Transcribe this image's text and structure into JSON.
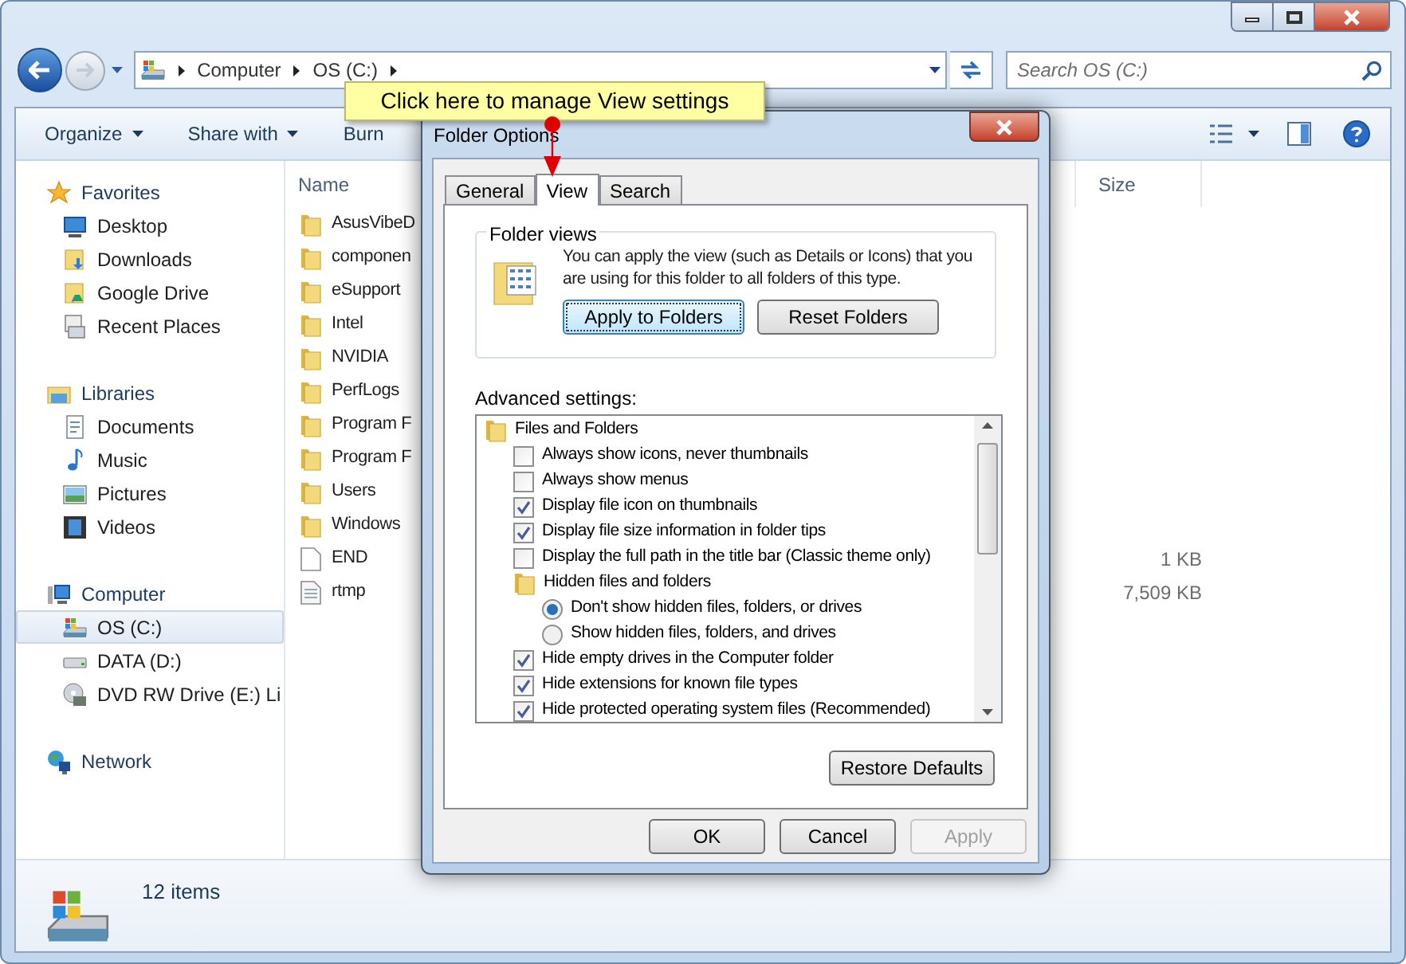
{
  "nav": {
    "breadcrumbs": [
      "Computer",
      "OS (C:)"
    ],
    "search": {
      "placeholder": "Search OS (C:)"
    }
  },
  "toolbar": [
    {
      "label": "Organize",
      "has_menu": true
    },
    {
      "label": "Share with",
      "has_menu": true
    },
    {
      "label": "Burn",
      "has_menu": false
    }
  ],
  "sidebar": [
    {
      "label": "Favorites",
      "selected": false,
      "children": [
        {
          "label": "Desktop",
          "selected": false
        },
        {
          "label": "Downloads",
          "selected": false
        },
        {
          "label": "Google Drive",
          "selected": false
        },
        {
          "label": "Recent Places",
          "selected": false
        }
      ]
    },
    {
      "label": "Libraries",
      "selected": false,
      "children": [
        {
          "label": "Documents",
          "selected": false
        },
        {
          "label": "Music",
          "selected": false
        },
        {
          "label": "Pictures",
          "selected": false
        },
        {
          "label": "Videos",
          "selected": false
        }
      ]
    },
    {
      "label": "Computer",
      "selected": false,
      "children": [
        {
          "label": "OS (C:)",
          "selected": true
        },
        {
          "label": "DATA (D:)",
          "selected": false
        },
        {
          "label": "DVD RW Drive (E:) Li",
          "selected": false
        }
      ]
    },
    {
      "label": "Network",
      "selected": false
    }
  ],
  "columns": [
    "Name",
    "Size"
  ],
  "files": [
    {
      "name": "AsusVibeD",
      "kind": "folder"
    },
    {
      "name": "componen",
      "kind": "folder"
    },
    {
      "name": "eSupport",
      "kind": "folder"
    },
    {
      "name": "Intel",
      "kind": "folder"
    },
    {
      "name": "NVIDIA",
      "kind": "folder"
    },
    {
      "name": "PerfLogs",
      "kind": "folder"
    },
    {
      "name": "Program F",
      "kind": "folder"
    },
    {
      "name": "Program F",
      "kind": "folder"
    },
    {
      "name": "Users",
      "kind": "folder"
    },
    {
      "name": "Windows",
      "kind": "folder"
    },
    {
      "name": "END",
      "kind": "file",
      "size": "1 KB"
    },
    {
      "name": "rtmp",
      "kind": "text",
      "size": "7,509 KB"
    }
  ],
  "status": "12 items",
  "callout": "Click here to manage View settings",
  "dialog": {
    "title": "Folder Options",
    "tabs": [
      {
        "label": "General",
        "selected": false
      },
      {
        "label": "View",
        "selected": true
      },
      {
        "label": "Search",
        "selected": false
      }
    ],
    "folder_views": {
      "label": "Folder views",
      "description": "You can apply the view (such as Details or Icons) that you are using for this folder to all folders of this type.",
      "buttons": [
        {
          "label": "Apply to Folders",
          "focused": true
        },
        {
          "label": "Reset Folders",
          "focused": false
        }
      ]
    },
    "advanced_label": "Advanced settings:",
    "settings": [
      {
        "kind": "group",
        "label": "Files and Folders",
        "children": [
          {
            "kind": "checkbox",
            "label": "Always show icons, never thumbnails",
            "checked": false
          },
          {
            "kind": "checkbox",
            "label": "Always show menus",
            "checked": false
          },
          {
            "kind": "checkbox",
            "label": "Display file icon on thumbnails",
            "checked": true
          },
          {
            "kind": "checkbox",
            "label": "Display file size information in folder tips",
            "checked": true
          },
          {
            "kind": "checkbox",
            "label": "Display the full path in the title bar (Classic theme only)",
            "checked": false
          },
          {
            "kind": "group",
            "label": "Hidden files and folders",
            "children": [
              {
                "kind": "radio",
                "label": "Don't show hidden files, folders, or drives",
                "selected": true
              },
              {
                "kind": "radio",
                "label": "Show hidden files, folders, and drives",
                "selected": false
              }
            ]
          },
          {
            "kind": "checkbox",
            "label": "Hide empty drives in the Computer folder",
            "checked": true
          },
          {
            "kind": "checkbox",
            "label": "Hide extensions for known file types",
            "checked": true
          },
          {
            "kind": "checkbox",
            "label": "Hide protected operating system files (Recommended)",
            "checked": true
          }
        ]
      }
    ],
    "restore_button": "Restore Defaults",
    "buttons": [
      {
        "label": "OK",
        "disabled": false
      },
      {
        "label": "Cancel",
        "disabled": false
      },
      {
        "label": "Apply",
        "disabled": true
      }
    ]
  }
}
